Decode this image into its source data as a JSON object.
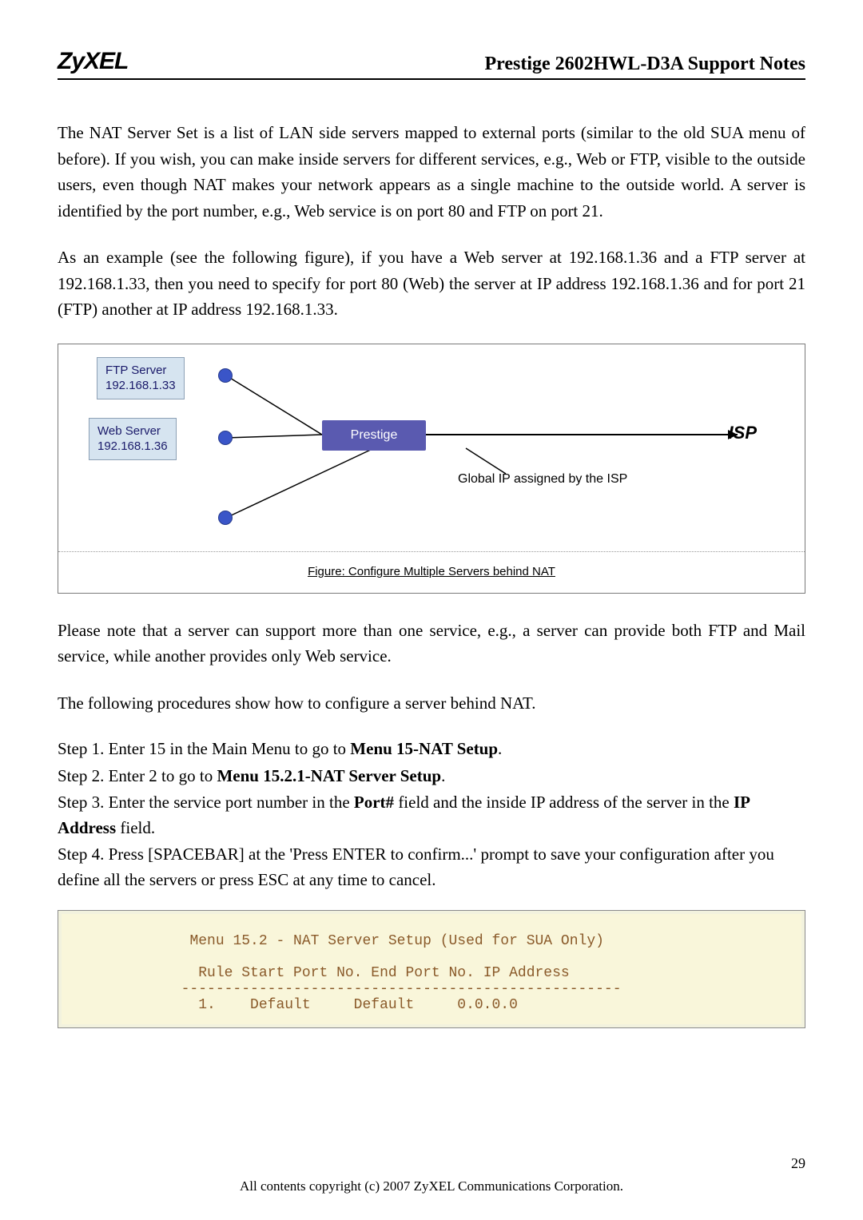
{
  "header": {
    "brand": "ZyXEL",
    "title": "Prestige 2602HWL-D3A Support Notes"
  },
  "paragraphs": {
    "p1": "The NAT Server Set is a list of LAN side servers mapped to external ports (similar to the old SUA menu of before). If you wish, you can make inside servers for different services, e.g., Web or FTP, visible to the outside users, even though NAT makes your network appears as a single machine to the outside world. A server is identified by the port number, e.g., Web service is on port 80 and FTP on port 21.",
    "p2": "As an example (see the following figure), if you have a Web server at 192.168.1.36 and a FTP server at 192.168.1.33, then you need to specify for port 80 (Web) the server at IP address 192.168.1.36 and for port 21 (FTP) another at IP address 192.168.1.33.",
    "p3": "Please note that a server can support more than one service, e.g., a server can provide both FTP and Mail service, while another provides only Web service.",
    "p4": "The following procedures show how to configure a server behind NAT."
  },
  "figure": {
    "ftp_label_line1": "FTP Server",
    "ftp_label_line2": "192.168.1.33",
    "web_label_line1": "Web Server",
    "web_label_line2": "192.168.1.36",
    "prestige": "Prestige",
    "isp": "ISP",
    "global_ip": "Global IP assigned by the ISP",
    "caption": "Figure: Configure Multiple Servers behind NAT"
  },
  "steps": {
    "s1_pre": "Step 1. Enter 15 in the Main Menu to go to ",
    "s1_bold": "Menu 15-NAT Setup",
    "s1_post": ".",
    "s2_pre": "Step 2. Enter 2 to go to ",
    "s2_bold": "Menu 15.2.1-NAT Server Setup",
    "s2_post": ".",
    "s3_pre": "Step 3. Enter the service port number in the ",
    "s3_bold1": "Port#",
    "s3_mid": " field and the inside IP address of the server in the ",
    "s3_bold2": "IP Address",
    "s3_post": " field.",
    "s4": "Step 4. Press [SPACEBAR] at the 'Press ENTER to confirm...' prompt to save your configuration after you define all the servers or press ESC at any time to cancel."
  },
  "terminal": {
    "title": "Menu 15.2 - NAT Server Setup (Used for SUA Only)",
    "header": "Rule Start Port No. End Port No. IP Address",
    "divider": "---------------------------------------------------",
    "row1": "  1.    Default     Default     0.0.0.0"
  },
  "footer": {
    "page": "29",
    "copyright": "All contents copyright (c) 2007 ZyXEL Communications Corporation."
  }
}
